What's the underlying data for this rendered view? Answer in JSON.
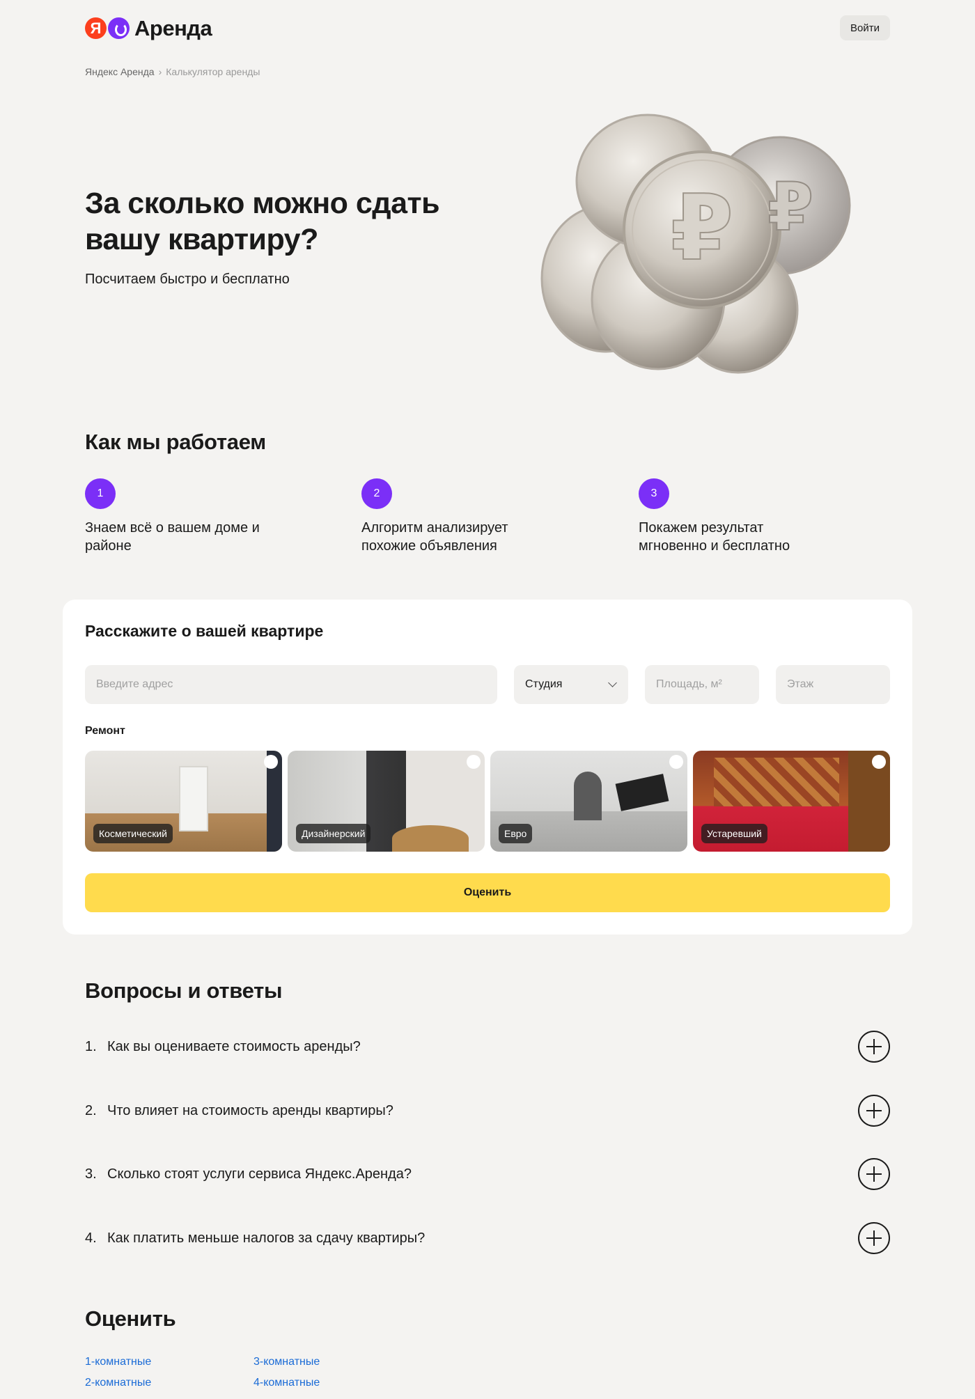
{
  "header": {
    "logo_mark": "Я",
    "logo_text": "Аренда",
    "login_label": "Войти"
  },
  "breadcrumb": {
    "items": [
      "Яндекс Аренда",
      "Калькулятор аренды"
    ],
    "separator": "›"
  },
  "hero": {
    "title": "За сколько можно сдать вашу квартиру?",
    "subtitle": "Посчитаем быстро и бесплатно"
  },
  "how_it_works": {
    "title": "Как мы работаем",
    "steps": [
      {
        "num": "1",
        "text": "Знаем всё о вашем доме и районе"
      },
      {
        "num": "2",
        "text": "Алгоритм анализирует похожие объявления"
      },
      {
        "num": "3",
        "text": "Покажем результат мгновенно и бесплатно"
      }
    ]
  },
  "form": {
    "title": "Расскажите о вашей квартире",
    "address_placeholder": "Введите адрес",
    "rooms_value": "Студия",
    "area_placeholder": "Площадь, м²",
    "floor_placeholder": "Этаж",
    "repair_label": "Ремонт",
    "repair_options": [
      "Косметический",
      "Дизайнерский",
      "Евро",
      "Устаревший"
    ],
    "submit_label": "Оценить"
  },
  "faq": {
    "title": "Вопросы и ответы",
    "items": [
      {
        "num": "1.",
        "question": "Как вы оцениваете стоимость аренды?"
      },
      {
        "num": "2.",
        "question": "Что влияет на стоимость аренды квартиры?"
      },
      {
        "num": "3.",
        "question": "Сколько стоят услуги сервиса Яндекс.Аренда?"
      },
      {
        "num": "4.",
        "question": "Как платить меньше налогов за сдачу квартиры?"
      }
    ]
  },
  "estimate": {
    "title": "Оценить",
    "links": [
      "1-комнатные",
      "3-комнатные",
      "2-комнатные",
      "4-комнатные"
    ]
  },
  "colors": {
    "accent_purple": "#7b2ff7",
    "button_yellow": "#ffdb4d",
    "link_blue": "#1a6bd6",
    "logo_red": "#fc3f1d"
  }
}
